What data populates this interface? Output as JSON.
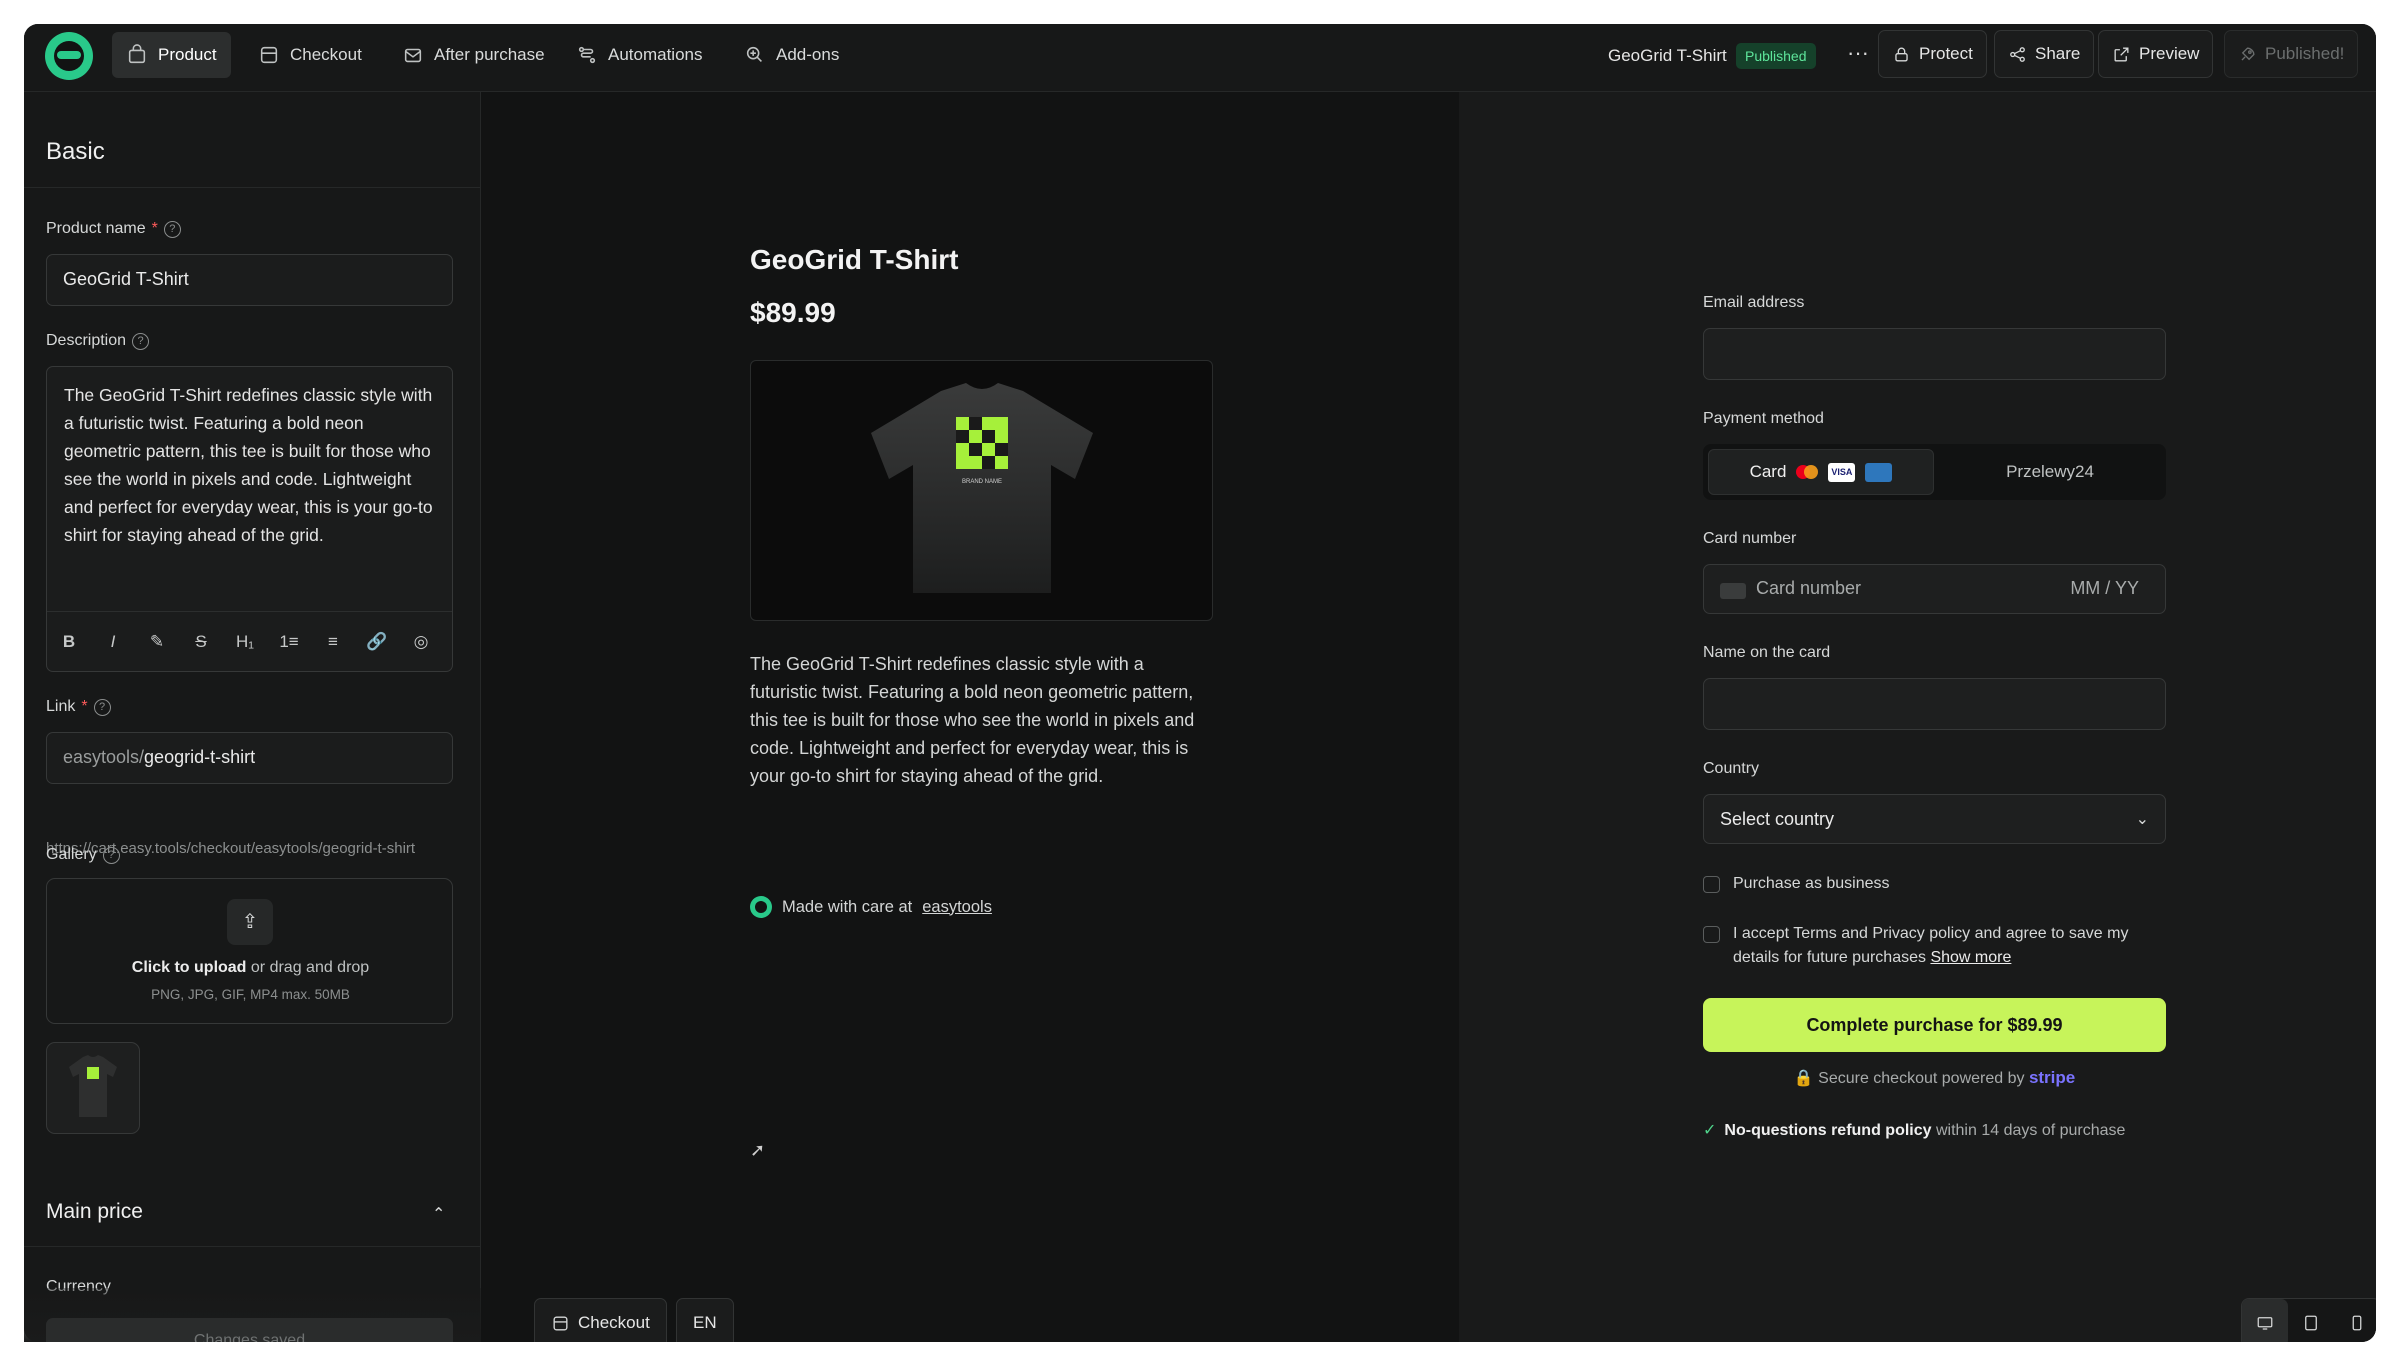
{
  "nav": {
    "tabs": [
      {
        "label": "Product",
        "icon": "bag-icon"
      },
      {
        "label": "Checkout",
        "icon": "checkout-icon"
      },
      {
        "label": "After purchase",
        "icon": "envelope-icon"
      },
      {
        "label": "Automations",
        "icon": "automation-icon"
      },
      {
        "label": "Add-ons",
        "icon": "addon-icon"
      }
    ],
    "product_title": "GeoGrid T-Shirt",
    "status_badge": "Published",
    "more": "···",
    "protect": "Protect",
    "share": "Share",
    "preview": "Preview",
    "published": "Published!"
  },
  "sidebar": {
    "section_basic": "Basic",
    "product_name_label": "Product name",
    "required_mark": "*",
    "help_mark": "?",
    "product_name_value": "GeoGrid T-Shirt",
    "description_label": "Description",
    "description_value": "The GeoGrid T-Shirt redefines classic style with a futuristic twist. Featuring a bold neon geometric pattern, this tee is built for those who see the world in pixels and code. Lightweight and perfect for everyday wear, this is your go-to shirt for staying ahead of the grid.",
    "toolbar": [
      "B",
      "I",
      "✎",
      "S",
      "H₁",
      "1≡",
      "≡",
      "🔗",
      "◎"
    ],
    "link_label": "Link",
    "link_prefix": "easytools/",
    "link_value": "geogrid-t-shirt",
    "link_url": "https://cart.easy.tools/checkout/easytools/geogrid-t-shirt",
    "gallery_label": "Gallery",
    "upload_strong": "Click to upload",
    "upload_rest": " or drag and drop",
    "upload_formats": "PNG, JPG, GIF, MP4 max. 50MB",
    "section_main_price": "Main price",
    "currency_label": "Currency",
    "changes_saved": "Changes saved"
  },
  "preview": {
    "title": "GeoGrid T-Shirt",
    "price": "$89.99",
    "description": "The GeoGrid T-Shirt redefines classic style with a futuristic twist. Featuring a bold neon geometric pattern, this tee is built for those who see the world in pixels and code. Lightweight and perfect for everyday wear, this is your go-to shirt for staying ahead of the grid.",
    "made_with": "Made with care at",
    "made_with_link": "easytools",
    "tshirt_print": "BRAND NAME",
    "checkout_button": "Checkout",
    "language": "EN"
  },
  "checkout": {
    "email_label": "Email address",
    "payment_label": "Payment method",
    "card_tab": "Card",
    "visa": "VISA",
    "p24_tab": "Przelewy24",
    "card_number_label": "Card number",
    "card_number_placeholder": "Card number",
    "expiry_placeholder": "MM / YY",
    "name_label": "Name on the card",
    "country_label": "Country",
    "country_placeholder": "Select country",
    "business_label": "Purchase as business",
    "terms_text": "I accept Terms and Privacy policy and agree to save my details for future purchases",
    "show_more": "Show more",
    "cta": "Complete purchase for $89.99",
    "secure_text": "Secure checkout powered by",
    "stripe": "stripe",
    "refund_strong": "No-questions refund policy",
    "refund_rest": " within 14 days of purchase"
  },
  "colors": {
    "accent": "#c7f45a",
    "brand": "#29c98a",
    "badge_bg": "#15412a",
    "badge_text": "#5ee59b"
  }
}
